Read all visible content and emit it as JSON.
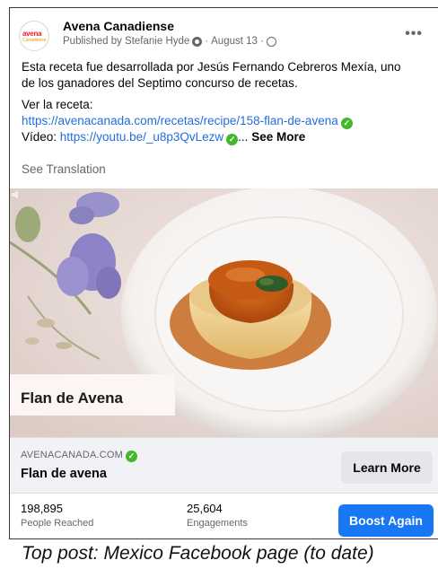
{
  "post": {
    "page_name": "Avena Canadiense",
    "published_by": "Published by Stefanie Hyde",
    "date": "August 13",
    "body": {
      "line1": "Esta receta fue desarrollada por Jesús Fernando Cebreros Mexía, uno",
      "line2": "de los ganadores del Septimo concurso de recetas.",
      "line3": "Ver la receta:",
      "recipe_link": "https://avenacanada.com/recetas/recipe/158-flan-de-avena",
      "video_label": "Vídeo: ",
      "video_link": "https://youtu.be/_u8p3QvLezw",
      "ellipsis": "...",
      "see_more": "See More"
    },
    "see_translation": "See Translation",
    "more_label": "•••"
  },
  "avatar": {
    "line1": "avena",
    "line2": "Canadiense"
  },
  "image": {
    "caption": "Flan de Avena"
  },
  "link_preview": {
    "domain": "AVENACANADA.COM",
    "title": "Flan de avena",
    "button": "Learn More"
  },
  "stats": {
    "reached_value": "198,895",
    "reached_label": "People Reached",
    "engagements_value": "25,604",
    "engagements_label": "Engagements",
    "boost_button": "Boost Again"
  },
  "footer_caption": "Top post: Mexico Facebook page (to date)",
  "colors": {
    "link": "#216fdb",
    "boost": "#1877f2",
    "verified": "#42b72a"
  }
}
